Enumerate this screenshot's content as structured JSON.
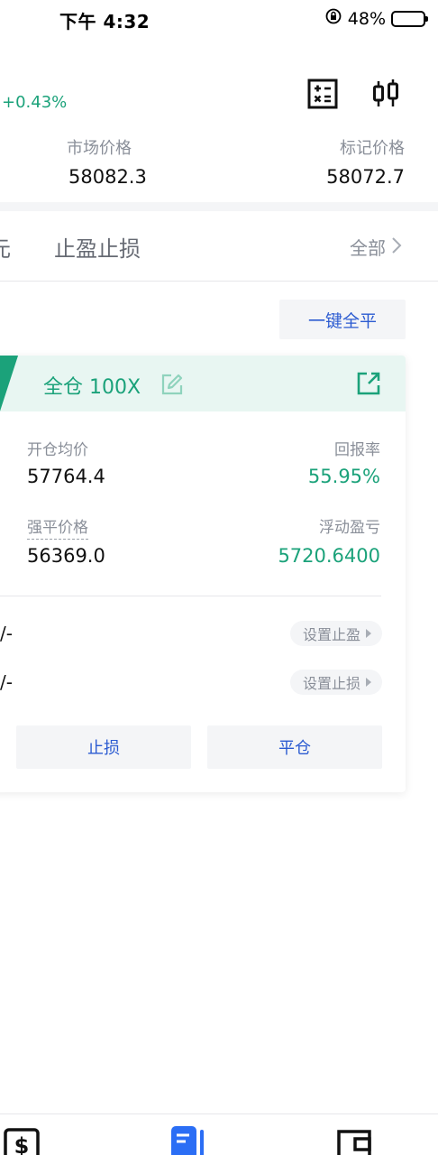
{
  "status": {
    "time": "下午 4:32",
    "battery_pct": "48%",
    "battery_level": 0.48
  },
  "header": {
    "change": "+0.43%",
    "market_price_label": "市场价格",
    "market_price": "58082.3",
    "mark_price_label": "标记价格",
    "mark_price": "58072.7"
  },
  "tabs": {
    "partial_left": "元",
    "tp_sl": "止盈止损",
    "all": "全部"
  },
  "close_all_label": "一键全平",
  "position": {
    "title": "全仓 100X",
    "avg_open_label": "开仓均价",
    "avg_open_value": "57764.4",
    "roe_label": "回报率",
    "roe_value": "55.95%",
    "liq_label": "强平价格",
    "liq_value": "56369.0",
    "pnl_label": "浮动盈亏",
    "pnl_value": "5720.6400",
    "tp_value": "/-",
    "tp_button": "设置止盈",
    "sl_value": "/-",
    "sl_button": "设置止损",
    "stop_loss_btn": "止损",
    "close_btn": "平仓"
  },
  "colors": {
    "green": "#1ba27a",
    "blue": "#2b5bd1"
  },
  "icons": [
    "calculator-icon",
    "candlestick-icon",
    "edit-icon",
    "share-icon",
    "chevron-right-icon",
    "dollar-icon",
    "orders-icon",
    "wallet-icon"
  ]
}
